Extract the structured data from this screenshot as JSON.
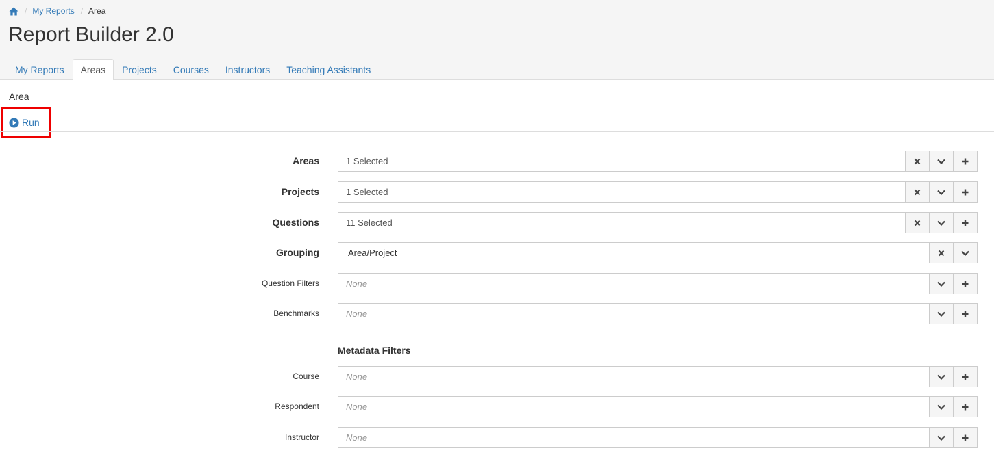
{
  "breadcrumb": {
    "home_icon": "home-icon",
    "items": [
      "My Reports",
      "Area"
    ]
  },
  "page": {
    "title": "Report Builder 2.0"
  },
  "tabs": [
    {
      "label": "My Reports",
      "active": false
    },
    {
      "label": "Areas",
      "active": true
    },
    {
      "label": "Projects",
      "active": false
    },
    {
      "label": "Courses",
      "active": false
    },
    {
      "label": "Instructors",
      "active": false
    },
    {
      "label": "Teaching Assistants",
      "active": false
    }
  ],
  "section": {
    "label": "Area",
    "run_label": "Run",
    "run_icon": "play-circle-icon"
  },
  "fields": {
    "areas": {
      "label": "Areas",
      "value": "1 Selected"
    },
    "projects": {
      "label": "Projects",
      "value": "1 Selected"
    },
    "questions": {
      "label": "Questions",
      "value": "11 Selected"
    },
    "grouping": {
      "label": "Grouping",
      "value": "Area/Project"
    },
    "question_filters": {
      "label": "Question Filters",
      "value": "None"
    },
    "benchmarks": {
      "label": "Benchmarks",
      "value": "None"
    }
  },
  "metadata": {
    "heading": "Metadata Filters",
    "course": {
      "label": "Course",
      "value": "None"
    },
    "respondent": {
      "label": "Respondent",
      "value": "None"
    },
    "instructor": {
      "label": "Instructor",
      "value": "None"
    }
  },
  "colors": {
    "link": "#337ab7",
    "highlight": "#ee0000",
    "header_bg": "#f5f5f5"
  }
}
